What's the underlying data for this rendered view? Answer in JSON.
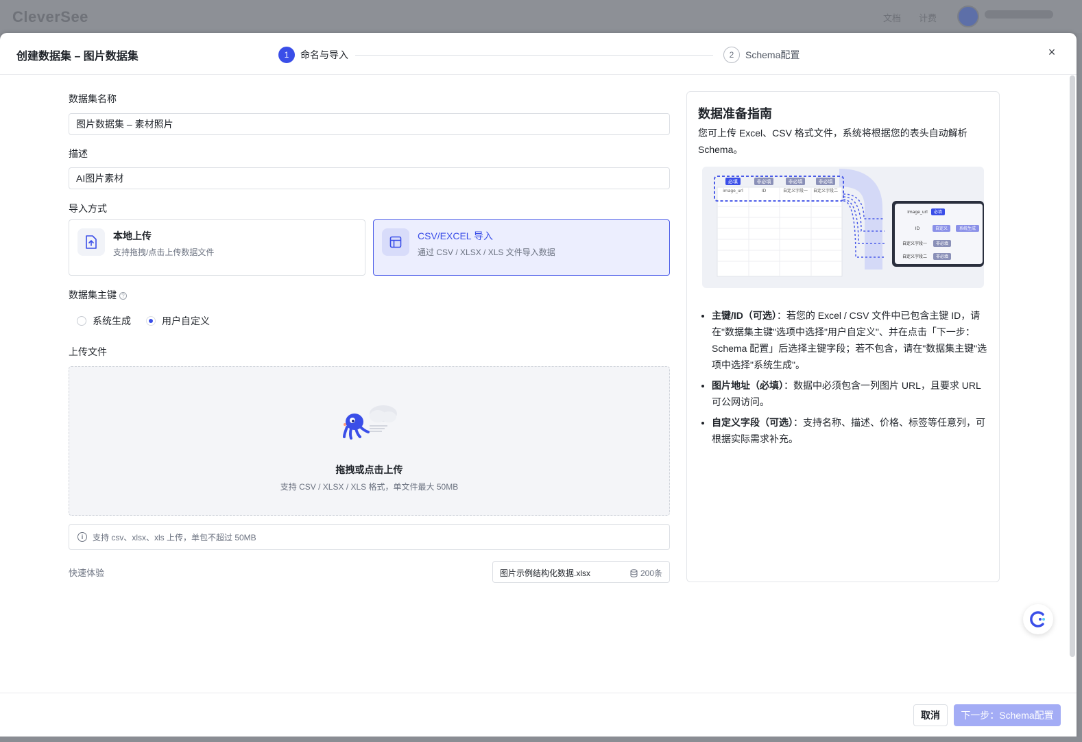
{
  "app": {
    "logo": "CleverSee",
    "nav": [
      "文档",
      "计费"
    ]
  },
  "modal": {
    "title": "创建数据集 – 图片数据集",
    "steps": [
      {
        "num": "1",
        "label": "命名与导入"
      },
      {
        "num": "2",
        "label": "Schema配置"
      }
    ],
    "close": "×"
  },
  "form": {
    "name_label": "数据集名称",
    "name_value": "图片数据集 – 素材照片",
    "desc_label": "描述",
    "desc_value": "AI图片素材",
    "import_label": "导入方式",
    "import_options": [
      {
        "title": "本地上传",
        "desc": "支持拖拽/点击上传数据文件",
        "selected": false
      },
      {
        "title": "CSV/EXCEL 导入",
        "desc": "通过 CSV / XLSX / XLS 文件导入数据",
        "selected": true
      }
    ],
    "pk_label": "数据集主键",
    "pk_options": [
      {
        "label": "系统生成",
        "checked": false
      },
      {
        "label": "用户自定义",
        "checked": true
      }
    ],
    "upload_label": "上传文件",
    "upload_title": "拖拽或点击上传",
    "upload_desc": "支持 CSV / XLSX / XLS 格式，单文件最大 50MB",
    "tip": "支持 csv、xlsx、xls 上传，单包不超过 50MB",
    "quick_label": "快速体验",
    "sample_file": "图片示例结构化数据.xlsx",
    "sample_count": "200条"
  },
  "guide": {
    "title": "数据准备指南",
    "desc": "您可上传 Excel、CSV 格式文件，系统将根据您的表头自动解析 Schema。",
    "illus": {
      "tags": [
        "必填",
        "非必填",
        "非必填",
        "非必填"
      ],
      "cols": [
        "image_url",
        "ID",
        "自定义字段一",
        "自定义字段二"
      ],
      "right_rows": [
        "image_url",
        "ID",
        "自定义字段一",
        "自定义字段二"
      ],
      "right_tags": [
        "必填",
        "自定义",
        "系统生成",
        "非必填",
        "非必填"
      ]
    },
    "items": [
      {
        "head": "主键/ID（可选）",
        "text": "：若您的 Excel / CSV 文件中已包含主键 ID，请在\"数据集主键\"选项中选择\"用户自定义\"、并在点击「下一步：Schema 配置」后选择主键字段；若不包含，请在\"数据集主键\"选项中选择\"系统生成\"。"
      },
      {
        "head": "图片地址（必填）",
        "text": "：数据中必须包含一列图片 URL，且要求 URL 可公网访问。"
      },
      {
        "head": "自定义字段（可选）",
        "text": "：支持名称、描述、价格、标签等任意列，可根据实际需求补充。"
      }
    ]
  },
  "footer": {
    "cancel": "取消",
    "next": "下一步：Schema配置"
  },
  "colors": {
    "primary": "#3a4ee8",
    "primary_disabled": "#a3acf5",
    "selected_bg": "#eceefe"
  }
}
